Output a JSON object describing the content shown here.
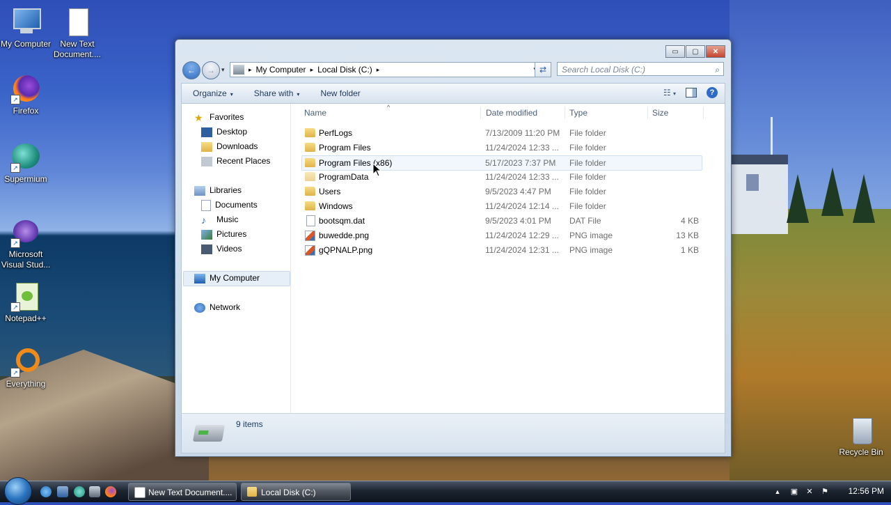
{
  "desktop": {
    "icons": [
      {
        "label": "My Computer",
        "icon": "computer-icon"
      },
      {
        "label": "New Text Document....",
        "icon": "text-document-icon"
      },
      {
        "label": "Firefox",
        "icon": "firefox-icon"
      },
      {
        "label": "Supermium",
        "icon": "supermium-icon"
      },
      {
        "label": "Microsoft Visual Stud...",
        "icon": "visual-studio-icon"
      },
      {
        "label": "Notepad++",
        "icon": "notepadpp-icon"
      },
      {
        "label": "Everything",
        "icon": "everything-icon"
      },
      {
        "label": "Recycle Bin",
        "icon": "recycle-bin-icon"
      }
    ]
  },
  "window": {
    "caption_buttons": {
      "minimize": "▭",
      "maximize": "▢",
      "close": "✕"
    },
    "address": {
      "crumbs": [
        "My Computer",
        "Local Disk (C:)"
      ],
      "separator": "▸",
      "dropdown": "▾"
    },
    "refresh": "⇄",
    "search": {
      "placeholder": "Search Local Disk (C:)",
      "icon": "magnifier-icon"
    },
    "toolbar": {
      "organize": "Organize",
      "share_with": "Share with",
      "new_folder": "New folder",
      "arrow": "▾",
      "views_icon": "☷",
      "help": "?"
    },
    "nav": {
      "favorites": "Favorites",
      "desktop": "Desktop",
      "downloads": "Downloads",
      "recent_places": "Recent Places",
      "libraries": "Libraries",
      "documents": "Documents",
      "music": "Music",
      "pictures": "Pictures",
      "videos": "Videos",
      "my_computer": "My Computer",
      "network": "Network"
    },
    "columns": {
      "name": "Name",
      "date": "Date modified",
      "type": "Type",
      "size": "Size",
      "sort_arrow": "^"
    },
    "files": [
      {
        "name": "PerfLogs",
        "date": "7/13/2009 11:20 PM",
        "type": "File folder",
        "size": "",
        "kind": "folder"
      },
      {
        "name": "Program Files",
        "date": "11/24/2024 12:33 ...",
        "type": "File folder",
        "size": "",
        "kind": "folder"
      },
      {
        "name": "Program Files (x86)",
        "date": "5/17/2023 7:37 PM",
        "type": "File folder",
        "size": "",
        "kind": "folder"
      },
      {
        "name": "ProgramData",
        "date": "11/24/2024 12:33 ...",
        "type": "File folder",
        "size": "",
        "kind": "folder"
      },
      {
        "name": "Users",
        "date": "9/5/2023 4:47 PM",
        "type": "File folder",
        "size": "",
        "kind": "folder"
      },
      {
        "name": "Windows",
        "date": "11/24/2024 12:14 ...",
        "type": "File folder",
        "size": "",
        "kind": "folder"
      },
      {
        "name": "bootsqm.dat",
        "date": "9/5/2023 4:01 PM",
        "type": "DAT File",
        "size": "4 KB",
        "kind": "file"
      },
      {
        "name": "buwedde.png",
        "date": "11/24/2024 12:29 ...",
        "type": "PNG image",
        "size": "13 KB",
        "kind": "png"
      },
      {
        "name": "gQPNALP.png",
        "date": "11/24/2024 12:31 ...",
        "type": "PNG image",
        "size": "1 KB",
        "kind": "png"
      }
    ],
    "status": {
      "items": "9 items"
    }
  },
  "taskbar": {
    "buttons": [
      {
        "label": "New Text Document....",
        "icon": "notepad-icon"
      },
      {
        "label": "Local Disk (C:)",
        "icon": "explorer-icon"
      }
    ],
    "tray": {
      "up": "▲",
      "clock": "12:56 PM"
    }
  },
  "colors": {
    "accent": "#2f6bc0",
    "taskbar": "#1c2430",
    "selection": "#e6eef7"
  }
}
